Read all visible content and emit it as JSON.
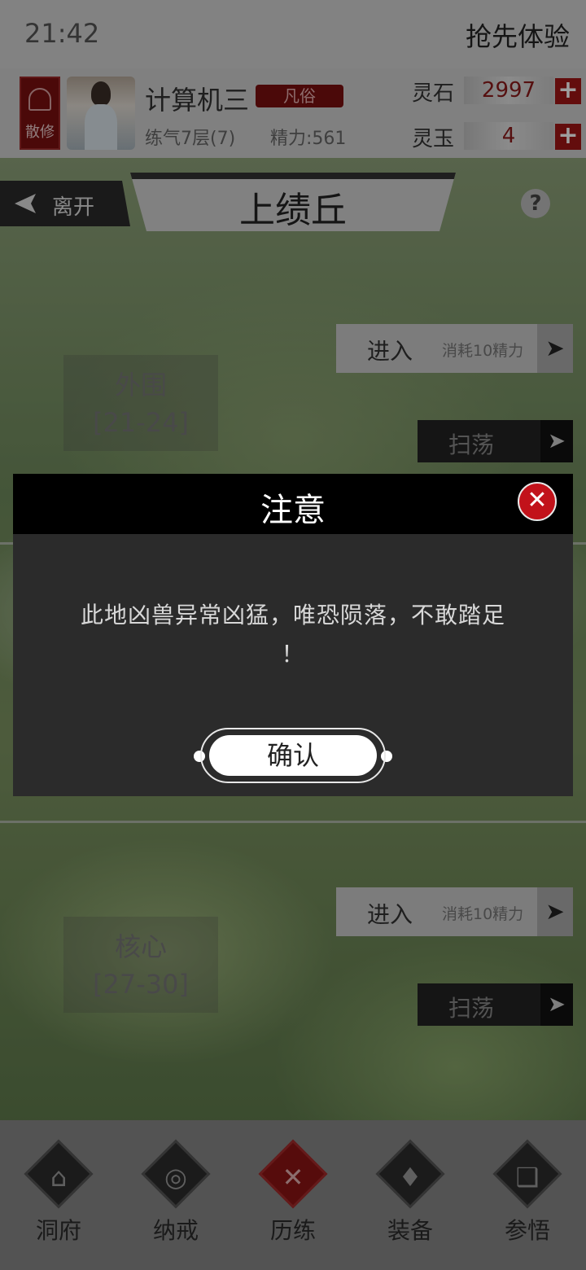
{
  "status_bar": {
    "time": "21:42",
    "trial_label": "抢先体验"
  },
  "player": {
    "sect_badge": "散修",
    "name": "计算机三",
    "rank": "凡俗",
    "realm": "练气7层(7)",
    "energy": "精力:561"
  },
  "currencies": [
    {
      "label": "灵石",
      "value": "2997",
      "add_label": "+"
    },
    {
      "label": "灵玉",
      "value": "4",
      "add_label": "+"
    }
  ],
  "location": {
    "leave_label": "离开",
    "title": "上绩丘",
    "help_label": "?"
  },
  "zones": [
    {
      "name": "外围",
      "range": "[21-24]",
      "enter_label": "进入",
      "cost": "消耗10精力",
      "sweep_label": "扫荡"
    },
    {
      "name": "核心",
      "range": "[27-30]",
      "enter_label": "进入",
      "cost": "消耗10精力",
      "sweep_label": "扫荡"
    }
  ],
  "dialog": {
    "title": "注意",
    "message_line1": "此地凶兽异常凶猛，唯恐陨落，不敢踏足",
    "message_line2": "！",
    "confirm_label": "确认",
    "close_label": "✕"
  },
  "bottom_nav": [
    {
      "label": "洞府",
      "glyph": "⌂",
      "icon": "cave-dwelling-icon",
      "active": false
    },
    {
      "label": "纳戒",
      "glyph": "◎",
      "icon": "ring-icon",
      "active": false
    },
    {
      "label": "历练",
      "glyph": "✕",
      "icon": "crossed-swords-icon",
      "active": true
    },
    {
      "label": "装备",
      "glyph": "♦",
      "icon": "dagger-icon",
      "active": false
    },
    {
      "label": "参悟",
      "glyph": "❑",
      "icon": "open-book-icon",
      "active": false
    }
  ],
  "colors": {
    "accent_red": "#a01616",
    "dialog_bg": "#2b2b2b",
    "header_bg": "#cfcfcf"
  }
}
